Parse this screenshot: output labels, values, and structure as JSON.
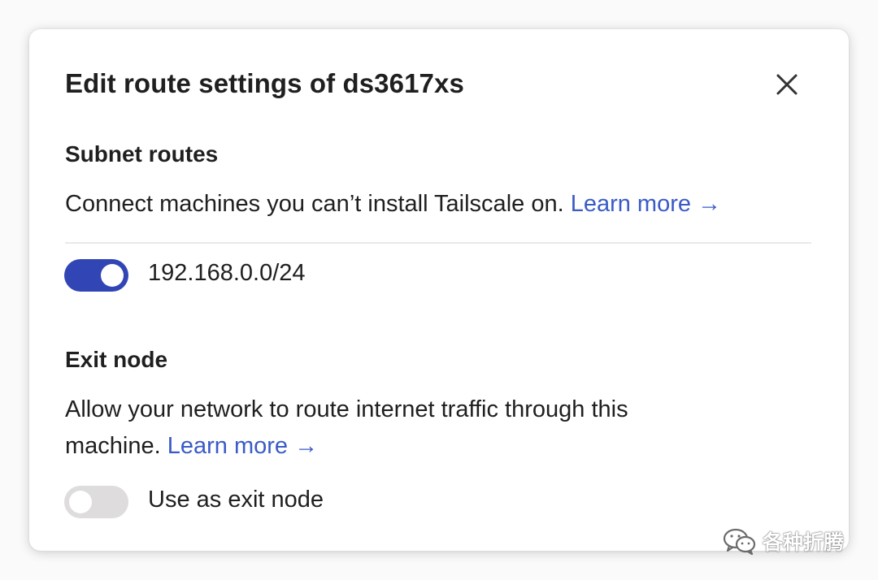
{
  "dialog": {
    "title": "Edit route settings of ds3617xs",
    "close_icon": "close-icon"
  },
  "subnet_routes": {
    "heading": "Subnet routes",
    "description": "Connect machines you can’t install Tailscale on.",
    "learn_more": "Learn more →",
    "routes": [
      {
        "label": "192.168.0.0/24",
        "enabled": true
      }
    ]
  },
  "exit_node": {
    "heading": "Exit node",
    "description_line1": "Allow your network to route internet traffic through this",
    "description_line2": "machine.",
    "learn_more": "Learn more →",
    "toggle_label": "Use as exit node",
    "enabled": false
  },
  "watermark": {
    "icon": "wechat-icon",
    "text": "各种折腾"
  },
  "colors": {
    "accent": "#3145b5",
    "link": "#3a5bc7",
    "toggle_off": "#dedcdc"
  }
}
